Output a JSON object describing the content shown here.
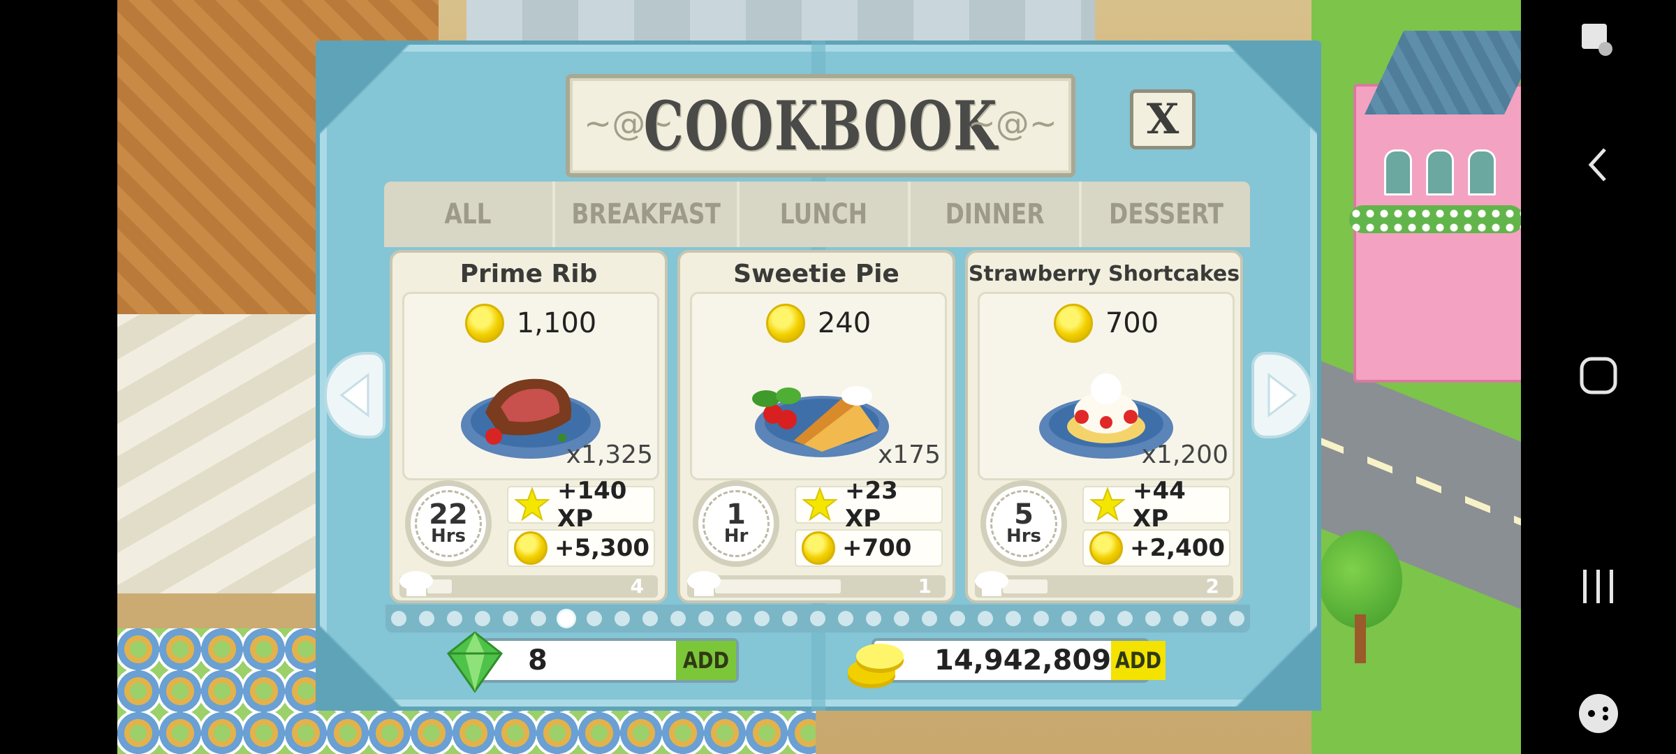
{
  "dialog": {
    "title": "COOKBOOK",
    "close_label": "X"
  },
  "tabs": [
    {
      "label": "ALL",
      "active": true
    },
    {
      "label": "BREAKFAST",
      "active": false
    },
    {
      "label": "LUNCH",
      "active": false
    },
    {
      "label": "DINNER",
      "active": false
    },
    {
      "label": "DESSERT",
      "active": false
    }
  ],
  "recipes": [
    {
      "name": "Prime Rib",
      "price": "1,100",
      "servings": "x1,325",
      "time_value": "22",
      "time_unit": "Hrs",
      "xp": "+140 XP",
      "coins": "+5,300",
      "level": "4",
      "progress": 0.12
    },
    {
      "name": "Sweetie Pie",
      "price": "240",
      "servings": "x175",
      "time_value": "1",
      "time_unit": "Hr",
      "xp": "+23 XP",
      "coins": "+700",
      "level": "1",
      "progress": 0.62
    },
    {
      "name": "Strawberry Shortcakes",
      "price": "700",
      "servings": "x1,200",
      "time_value": "5",
      "time_unit": "Hrs",
      "xp": "+44 XP",
      "coins": "+2,400",
      "level": "2",
      "progress": 0.22
    }
  ],
  "pagination": {
    "total": 31,
    "current": 7
  },
  "currency": {
    "gems": "8",
    "gems_add_label": "ADD",
    "coins": "14,942,809",
    "coins_add_label": "ADD"
  },
  "icons": {
    "prev": "chevron-left-icon",
    "next": "chevron-right-icon",
    "price": "coin-icon",
    "xp": "star-icon",
    "time": "clock-icon",
    "level": "chef-hat-icon",
    "gem": "green-gem-icon"
  },
  "colors": {
    "dialog_bg": "#84c5d6",
    "active_tab": "#ffffff",
    "gem_add": "#7cc63a",
    "coin_add": "#f4e200"
  }
}
